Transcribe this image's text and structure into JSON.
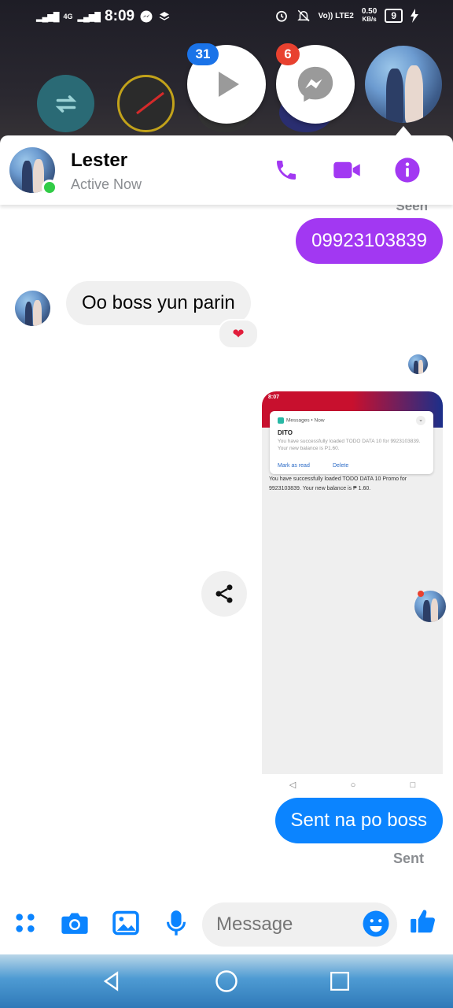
{
  "status_bar": {
    "network": "4G",
    "time": "8:09",
    "volte": "Vo)) LTE2",
    "speed": "0.50",
    "speed_unit": "KB/s",
    "battery": "9"
  },
  "chat_heads": {
    "video_badge": "31",
    "messenger_badge": "6"
  },
  "header": {
    "name": "Lester",
    "status": "Active Now"
  },
  "messages": {
    "seen_label": "Seen",
    "outgoing_number": "09923103839",
    "incoming_text": "Oo boss yun parin",
    "reaction": "❤",
    "outgoing_sent": "Sent na po boss",
    "sent_label": "Sent"
  },
  "screenshot": {
    "status_time": "8:07",
    "notif_app": "Messages • Now",
    "notif_title": "DITO",
    "notif_body": "You have successfully loaded TODO DATA 10 for 9923103839. Your new balance is P1.60.",
    "notif_action_1": "Mark as read",
    "notif_action_2": "Delete",
    "message_text": "You have successfully loaded TODO DATA 10 Promo for 9923103839. Your new balance is ₱ 1.60."
  },
  "composer": {
    "placeholder": "Message"
  },
  "colors": {
    "messenger_purple": "#a238f2",
    "messenger_blue": "#0b84ff",
    "online_green": "#31cc46"
  }
}
